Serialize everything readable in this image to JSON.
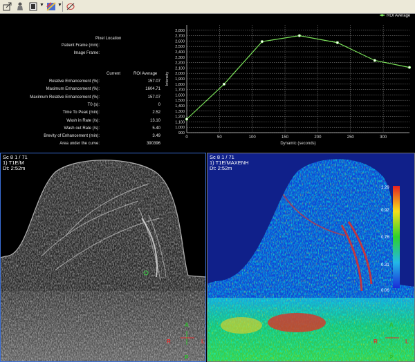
{
  "toolbar": {
    "icons": [
      "export-icon",
      "person-icon",
      "window-level-icon",
      "colormap-icon",
      "roi-icon"
    ]
  },
  "stats": {
    "pixel_location_label": "Pixel Location",
    "patient_frame_label": "Patient Frame (mm):",
    "image_frame_label": "Image Frame:",
    "col_current": "Current",
    "col_roi_average": "ROI Average",
    "rows": [
      {
        "label": "Relative Enhancement (%):",
        "value": "157.07"
      },
      {
        "label": "Maximum Enhancement (%):",
        "value": "1604.71"
      },
      {
        "label": "Maximum Relative Enhancement (%):",
        "value": "157.07"
      },
      {
        "label": "T0 (s):",
        "value": "0"
      },
      {
        "label": "Time To Peak (min):",
        "value": "2.52"
      },
      {
        "label": "Wash in Rate (/s):",
        "value": "13.10"
      },
      {
        "label": "Wash out Rate (/s):",
        "value": "5.40"
      },
      {
        "label": "Brevity of Enhancement (min):",
        "value": "3.49"
      },
      {
        "label": "Area under the curve:",
        "value": "390396"
      }
    ]
  },
  "chart_data": {
    "type": "line",
    "legend": "ROI Average",
    "legend_position": "top-right",
    "xlabel": "Dynamic (seconds)",
    "ylabel": "Intensity",
    "xlim": [
      0,
      340
    ],
    "ylim": [
      900,
      2900
    ],
    "xticks": [
      0,
      50,
      100,
      150,
      200,
      250,
      300
    ],
    "yticks": [
      900,
      1000,
      1100,
      1200,
      1300,
      1400,
      1500,
      1600,
      1700,
      1800,
      1900,
      2000,
      2100,
      2200,
      2300,
      2400,
      2500,
      2600,
      2700,
      2800
    ],
    "ytick_labels": [
      "900",
      "1,000",
      "1,100",
      "1,200",
      "1,300",
      "1,400",
      "1,500",
      "1,600",
      "1,700",
      "1,800",
      "1,900",
      "2,000",
      "2,100",
      "2,200",
      "2,300",
      "2,400",
      "2,500",
      "2,600",
      "2,700",
      "2,800"
    ],
    "grid": true,
    "color": "#7be35a",
    "x": [
      0,
      57,
      115,
      172,
      230,
      287,
      340
    ],
    "y": [
      1150,
      1800,
      2590,
      2700,
      2570,
      2240,
      2110
    ]
  },
  "viewer_left": {
    "line1": "Sc 8 1 / 71",
    "line2": "1) T1E/M",
    "line3": "Dt: 2:52m",
    "orient": {
      "top": "A",
      "bottom": "P",
      "left": "R",
      "right": "L"
    }
  },
  "viewer_right": {
    "line1": "Sc 8 1 / 71",
    "line2": "1) T1E/MAXENH",
    "line3": "Dt: 2:52m",
    "orient": {
      "top": "A",
      "bottom": "P",
      "left": "R",
      "right": "L"
    },
    "colorbar_labels": [
      "1.29",
      "0.92",
      "0.76",
      "0.31",
      "0.06"
    ]
  },
  "colors": {
    "toolbar_bg": "#ece9d8",
    "active_border": "#3a6fd8",
    "orient_green": "#30c030",
    "orient_red": "#e03030"
  }
}
